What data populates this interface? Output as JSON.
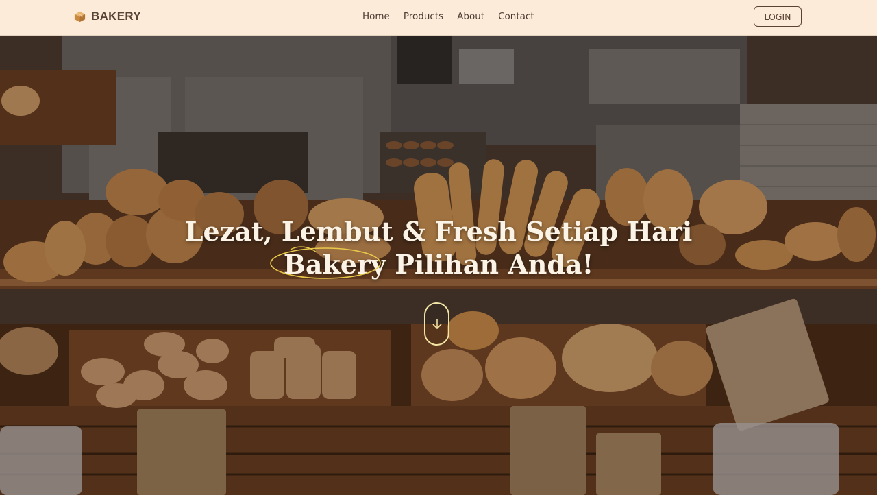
{
  "navbar": {
    "brand_icon": "box-icon",
    "brand": "BAKERY",
    "links": [
      "Home",
      "Products",
      "About",
      "Contact"
    ],
    "login_label": "LOGIN"
  },
  "hero": {
    "title_line1": "Lezat, Lembut & Fresh Setiap Hari",
    "highlight_word": "Bakery",
    "title_line2_rest": "Pilihan Anda!",
    "scroll_icon": "arrow-down-icon"
  },
  "colors": {
    "navbar_bg": "#fcebd9",
    "brand_text": "#5a4234",
    "hero_text": "#fbf3e6",
    "accent_ring": "#e8c94a"
  }
}
